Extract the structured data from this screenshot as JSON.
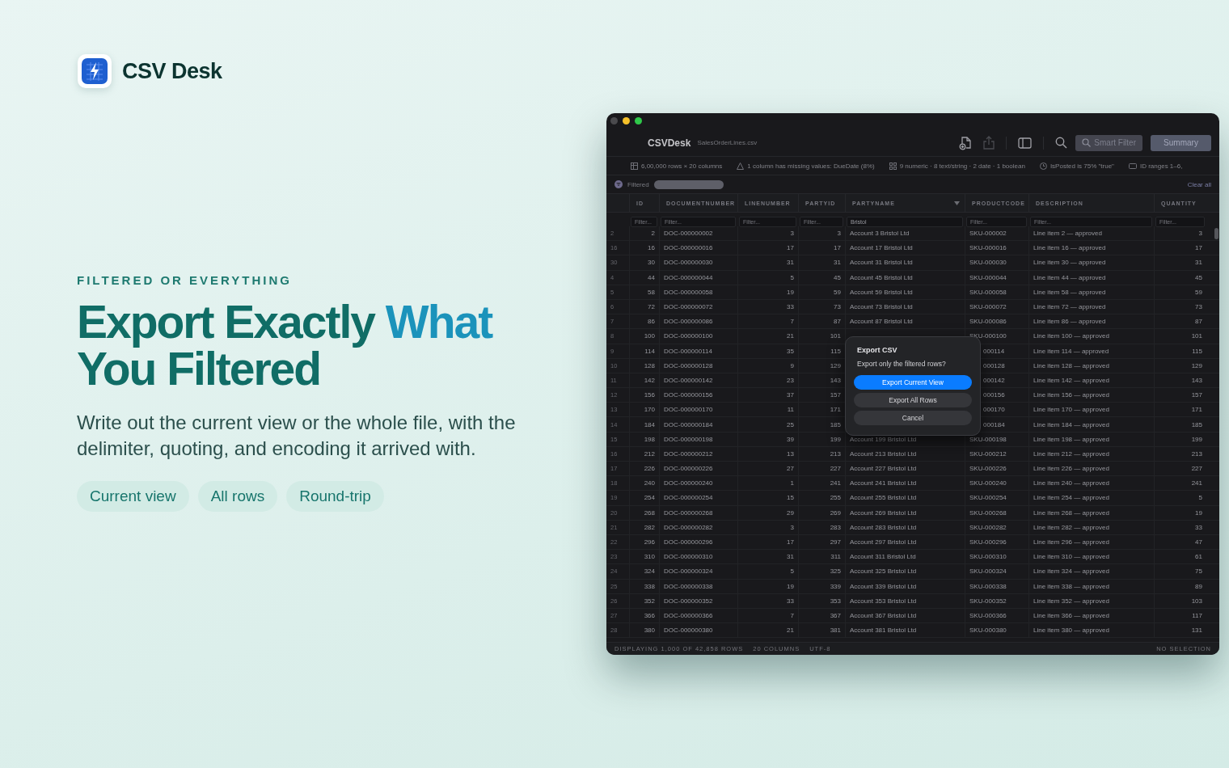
{
  "brand": {
    "name": "CSV Desk"
  },
  "hero": {
    "eyebrow": "FILTERED OR EVERYTHING",
    "headline": [
      {
        "text": "Export Exactly ",
        "accent": false
      },
      {
        "text": "What",
        "accent": true
      },
      {
        "text": " You Filtered",
        "accent": false
      }
    ],
    "body": "Write out the current view or the whole file, with the delimiter, quoting, and encoding it arrived with.",
    "chips": [
      "Current view",
      "All rows",
      "Round-trip"
    ]
  },
  "window": {
    "app_name": "CSVDesk",
    "file_name": "SalesOrderLines.csv",
    "smart_filter": "Smart Filter",
    "summary": "Summary",
    "info": [
      {
        "kind": "grid",
        "text": "6,00,000 rows × 20 columns"
      },
      {
        "kind": "warning",
        "text": "1 column has missing values: DueDate (8%)"
      },
      {
        "kind": "types",
        "text": "9 numeric · 8 text/string · 2 date · 1 boolean"
      },
      {
        "kind": "clock",
        "text": "IsPosted is 75% \"true\""
      },
      {
        "kind": "range",
        "text": "ID ranges 1–6,"
      }
    ],
    "filter_label": "Filtered",
    "clear_all": "Clear all",
    "columns": [
      {
        "label": "ID",
        "placeholder": "Filter...",
        "kind": "number"
      },
      {
        "label": "DOCUMENTNUMBER",
        "placeholder": "Filter...",
        "kind": "text"
      },
      {
        "label": "LINENUMBER",
        "placeholder": "Filter...",
        "kind": "number"
      },
      {
        "label": "PARTYID",
        "placeholder": "Filter...",
        "kind": "number"
      },
      {
        "label": "PARTYNAME",
        "value": "Bristol",
        "kind": "text",
        "sort_icon": true
      },
      {
        "label": "PRODUCTCODE",
        "placeholder": "Filter...",
        "kind": "text"
      },
      {
        "label": "DESCRIPTION",
        "placeholder": "Filter...",
        "kind": "text"
      },
      {
        "label": "QUANTITY",
        "placeholder": "Filter...",
        "kind": "number"
      }
    ],
    "rows": [
      {
        "n": "2",
        "cells": [
          "2",
          "DOC-000000002",
          "3",
          "3",
          "Account 3 Bristol Ltd",
          "SKU-000002",
          "Line item 2 — approved",
          "3"
        ]
      },
      {
        "n": "16",
        "cells": [
          "16",
          "DOC-000000016",
          "17",
          "17",
          "Account 17 Bristol Ltd",
          "SKU-000016",
          "Line item 16 — approved",
          "17"
        ]
      },
      {
        "n": "30",
        "cells": [
          "30",
          "DOC-000000030",
          "31",
          "31",
          "Account 31 Bristol Ltd",
          "SKU-000030",
          "Line item 30 — approved",
          "31"
        ]
      },
      {
        "n": "4",
        "cells": [
          "44",
          "DOC-000000044",
          "5",
          "45",
          "Account 45 Bristol Ltd",
          "SKU-000044",
          "Line item 44 — approved",
          "45"
        ]
      },
      {
        "n": "5",
        "cells": [
          "58",
          "DOC-000000058",
          "19",
          "59",
          "Account 59 Bristol Ltd",
          "SKU-000058",
          "Line item 58 — approved",
          "59"
        ]
      },
      {
        "n": "6",
        "cells": [
          "72",
          "DOC-000000072",
          "33",
          "73",
          "Account 73 Bristol Ltd",
          "SKU-000072",
          "Line item 72 — approved",
          "73"
        ]
      },
      {
        "n": "7",
        "cells": [
          "86",
          "DOC-000000086",
          "7",
          "87",
          "Account 87 Bristol Ltd",
          "SKU-000086",
          "Line item 86 — approved",
          "87"
        ]
      },
      {
        "n": "8",
        "cells": [
          "100",
          "DOC-000000100",
          "21",
          "101",
          "",
          "SKU-000100",
          "Line item 100 — approved",
          "101"
        ]
      },
      {
        "n": "9",
        "cells": [
          "114",
          "DOC-000000114",
          "35",
          "115",
          "",
          "000114",
          "Line item 114 — approved",
          "115"
        ]
      },
      {
        "n": "10",
        "cells": [
          "128",
          "DOC-000000128",
          "9",
          "129",
          "",
          "000128",
          "Line item 128 — approved",
          "129"
        ]
      },
      {
        "n": "11",
        "cells": [
          "142",
          "DOC-000000142",
          "23",
          "143",
          "",
          "000142",
          "Line item 142 — approved",
          "143"
        ]
      },
      {
        "n": "12",
        "cells": [
          "156",
          "DOC-000000156",
          "37",
          "157",
          "",
          "000156",
          "Line item 156 — approved",
          "157"
        ]
      },
      {
        "n": "13",
        "cells": [
          "170",
          "DOC-000000170",
          "11",
          "171",
          "",
          "000170",
          "Line item 170 — approved",
          "171"
        ]
      },
      {
        "n": "14",
        "cells": [
          "184",
          "DOC-000000184",
          "25",
          "185",
          "",
          "000184",
          "Line item 184 — approved",
          "185"
        ]
      },
      {
        "n": "15",
        "cells": [
          "198",
          "DOC-000000198",
          "39",
          "199",
          "Account 199 Bristol Ltd",
          "SKU-000198",
          "Line item 198 — approved",
          "199"
        ]
      },
      {
        "n": "16",
        "cells": [
          "212",
          "DOC-000000212",
          "13",
          "213",
          "Account 213 Bristol Ltd",
          "SKU-000212",
          "Line item 212 — approved",
          "213"
        ]
      },
      {
        "n": "17",
        "cells": [
          "226",
          "DOC-000000226",
          "27",
          "227",
          "Account 227 Bristol Ltd",
          "SKU-000226",
          "Line item 226 — approved",
          "227"
        ]
      },
      {
        "n": "18",
        "cells": [
          "240",
          "DOC-000000240",
          "1",
          "241",
          "Account 241 Bristol Ltd",
          "SKU-000240",
          "Line item 240 — approved",
          "241"
        ]
      },
      {
        "n": "19",
        "cells": [
          "254",
          "DOC-000000254",
          "15",
          "255",
          "Account 255 Bristol Ltd",
          "SKU-000254",
          "Line item 254 — approved",
          "5"
        ]
      },
      {
        "n": "20",
        "cells": [
          "268",
          "DOC-000000268",
          "29",
          "269",
          "Account 269 Bristol Ltd",
          "SKU-000268",
          "Line item 268 — approved",
          "19"
        ]
      },
      {
        "n": "21",
        "cells": [
          "282",
          "DOC-000000282",
          "3",
          "283",
          "Account 283 Bristol Ltd",
          "SKU-000282",
          "Line item 282 — approved",
          "33"
        ]
      },
      {
        "n": "22",
        "cells": [
          "296",
          "DOC-000000296",
          "17",
          "297",
          "Account 297 Bristol Ltd",
          "SKU-000296",
          "Line item 296 — approved",
          "47"
        ]
      },
      {
        "n": "23",
        "cells": [
          "310",
          "DOC-000000310",
          "31",
          "311",
          "Account 311 Bristol Ltd",
          "SKU-000310",
          "Line item 310 — approved",
          "61"
        ]
      },
      {
        "n": "24",
        "cells": [
          "324",
          "DOC-000000324",
          "5",
          "325",
          "Account 325 Bristol Ltd",
          "SKU-000324",
          "Line item 324 — approved",
          "75"
        ]
      },
      {
        "n": "25",
        "cells": [
          "338",
          "DOC-000000338",
          "19",
          "339",
          "Account 339 Bristol Ltd",
          "SKU-000338",
          "Line item 338 — approved",
          "89"
        ]
      },
      {
        "n": "26",
        "cells": [
          "352",
          "DOC-000000352",
          "33",
          "353",
          "Account 353 Bristol Ltd",
          "SKU-000352",
          "Line item 352 — approved",
          "103"
        ]
      },
      {
        "n": "27",
        "cells": [
          "366",
          "DOC-000000366",
          "7",
          "367",
          "Account 367 Bristol Ltd",
          "SKU-000366",
          "Line item 366 — approved",
          "117"
        ]
      },
      {
        "n": "28",
        "cells": [
          "380",
          "DOC-000000380",
          "21",
          "381",
          "Account 381 Bristol Ltd",
          "SKU-000380",
          "Line item 380 — approved",
          "131"
        ]
      }
    ],
    "dialog": {
      "title": "Export CSV",
      "message": "Export only the filtered rows?",
      "buttons": [
        {
          "label": "Export Current View",
          "kind": "primary"
        },
        {
          "label": "Export All Rows",
          "kind": "secondary"
        },
        {
          "label": "Cancel",
          "kind": "secondary"
        }
      ]
    },
    "status": {
      "left": [
        "DISPLAYING 1,000 OF 42,858 ROWS",
        "20 COLUMNS",
        "UTF-8"
      ],
      "right": "NO SELECTION"
    }
  }
}
